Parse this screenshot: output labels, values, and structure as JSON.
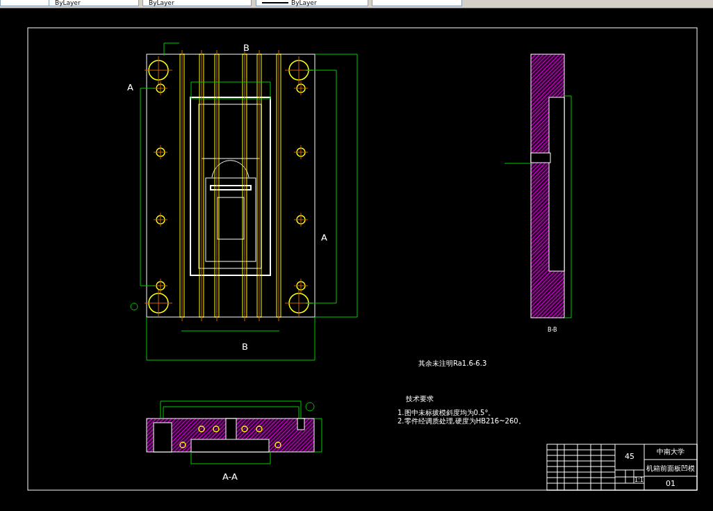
{
  "toolbar": {
    "dropdowns": [
      {
        "kind": "layer"
      },
      {
        "kind": "property",
        "value": "ByLayer"
      },
      {
        "kind": "property",
        "value": "ByLayer"
      },
      {
        "kind": "lineweight",
        "value": "ByLayer"
      },
      {
        "kind": "plot"
      }
    ]
  },
  "drawing": {
    "section_labels": [
      "B",
      "B",
      "A",
      "A"
    ],
    "view_titles": [
      "A-A",
      "B-B"
    ],
    "roughness_note": "其余未注明Ra1.6-6.3",
    "requirements_title": "技术要求",
    "requirements": [
      "1.图中未标拔模斜度均为0.5°。",
      "2.零件经调质处理,硬度为HB216~260。"
    ],
    "title_block": {
      "material": "45",
      "school": "中南大学",
      "part_name": "机箱前面板凹模",
      "scale": "1:1",
      "drawing_no": "01"
    }
  }
}
